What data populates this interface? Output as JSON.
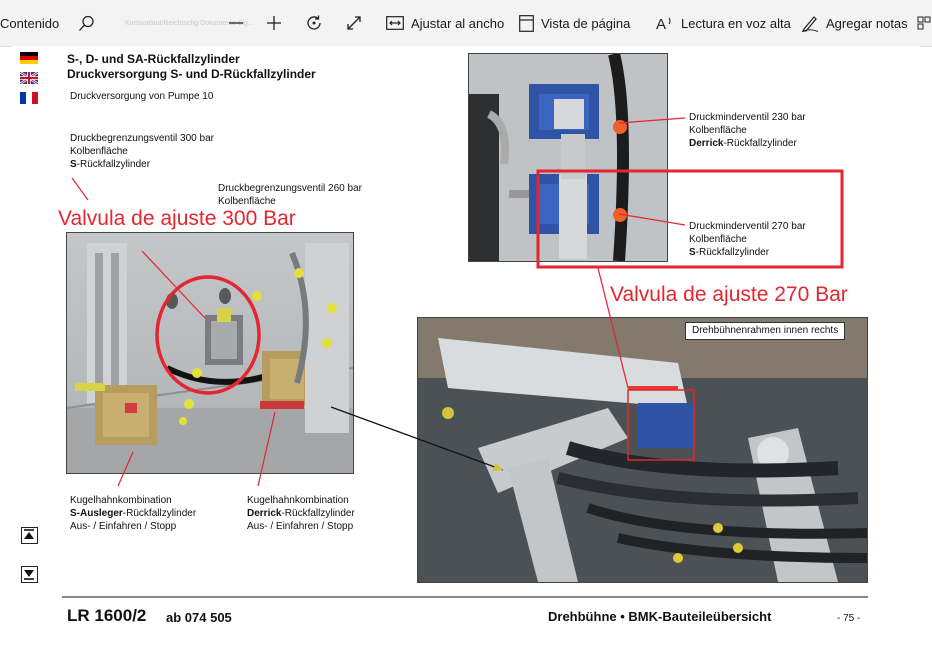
{
  "toolbar": {
    "contents_label": "Contenido",
    "page_badge": "Kursivatlaut/Reichtschg Dokumente Sig...",
    "fit_width_label": "Ajustar al ancho",
    "page_view_label": "Vista de página",
    "read_aloud_label": "Lectura en voz alta",
    "add_notes_label": "Agregar notas"
  },
  "doc": {
    "title_line1": "S-, D- und SA-Rückfallzylinder",
    "title_line2": "Druckversorgung S- und D-Rückfallzylinder",
    "supply_label": "Druckversorgung von Pumpe 10",
    "dbv300": {
      "l1": "Druckbegrenzungsventil 300 bar",
      "l2": "Kolbenfläche",
      "l3b": "S",
      "l3": "-Rückfallzylinder"
    },
    "dbv260": {
      "l1": "Druckbegrenzungsventil 260 bar",
      "l2": "Kolbenfläche"
    },
    "dmv230": {
      "l1": "Druckminderventil 230 bar",
      "l2": "Kolbenfläche",
      "l3b": "Derrick",
      "l3": "-Rückfallzylinder"
    },
    "dmv270": {
      "l1": "Druckminderventil 270 bar",
      "l2": "Kolbenfläche",
      "l3b": "S",
      "l3": "-Rückfallzylinder"
    },
    "frame_label": "Drehbühnenrahmen innen rechts",
    "kugel1": {
      "l1": "Kugelhahnkombination",
      "l2b": "S-Ausleger",
      "l2": "-Rückfallzylinder",
      "l3": "Aus- / Einfahren / Stopp"
    },
    "kugel2": {
      "l1": "Kugelhahnkombination",
      "l2b": "Derrick",
      "l2": "-Rückfallzylinder",
      "l3": "Aus- / Einfahren / Stopp"
    },
    "footer_model": "LR 1600/2",
    "footer_ab": "ab 074 505",
    "footer_section": "Drehbühne • BMK-Bauteileübersicht",
    "footer_page": "- 75 -"
  },
  "annotations": {
    "valve300": "Valvula de ajuste 300 Bar",
    "valve270": "Valvula de ajuste 270 Bar"
  },
  "colors": {
    "annotation_red": "#e3262f",
    "toolbar_bg": "#f3f3f3"
  }
}
